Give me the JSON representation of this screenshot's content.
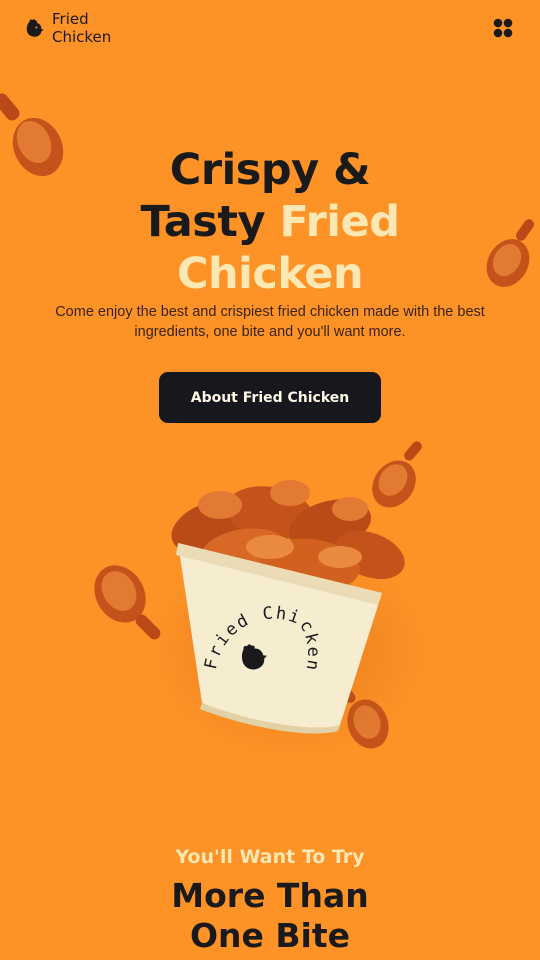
{
  "brand": {
    "name_line1": "Fried",
    "name_line2": "Chicken",
    "logo_icon": "chicken-head-icon",
    "menu_icon": "four-dots-menu-icon"
  },
  "hero": {
    "title_line1": "Crispy &",
    "title_line2_dark": "Tasty",
    "title_line2_highlight": "Fried",
    "title_line3": "Chicken",
    "description": "Come enjoy the best and crispiest fried chicken made with the best ingredients, one bite and you'll want more.",
    "cta_label": "About Fried Chicken"
  },
  "bucket": {
    "label": "Fried Chicken"
  },
  "section": {
    "subheading": "You'll Want To Try",
    "title_line1": "More Than",
    "title_line2": "One Bite"
  },
  "colors": {
    "background": "#fd9227",
    "dark": "#16181d",
    "highlight": "#fde8b3",
    "bucket": "#f6ecd0",
    "chicken": "#c4531b"
  }
}
